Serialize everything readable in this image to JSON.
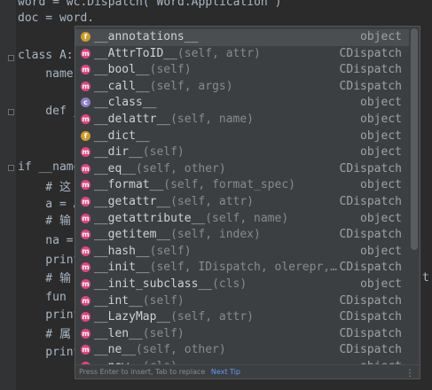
{
  "editor": {
    "lines": [
      {
        "text": "word = wc.Dispatch('Word.Application')"
      },
      {
        "text": "doc = word."
      },
      {
        "text": ""
      },
      {
        "text": "class A:"
      },
      {
        "text": "    name"
      },
      {
        "text": ""
      },
      {
        "text": "    def _"
      },
      {
        "text": ""
      },
      {
        "text": ""
      },
      {
        "text": "if __name"
      },
      {
        "text": "    # 这"
      },
      {
        "text": "    a = A"
      },
      {
        "text": "    # 输"
      },
      {
        "text": "    na ="
      },
      {
        "text": "    print"
      },
      {
        "text": "    # 输"
      },
      {
        "text": "    fun"
      },
      {
        "text": "    print"
      },
      {
        "text": "    # 属"
      },
      {
        "text": "    print"
      }
    ],
    "right_edge_char": "t"
  },
  "completion": {
    "items": [
      {
        "icon": "f",
        "name": "__annotations__",
        "sig": "",
        "type": "object"
      },
      {
        "icon": "m",
        "name": "__AttrToID__",
        "sig": "(self, attr)",
        "type": "CDispatch"
      },
      {
        "icon": "m",
        "name": "__bool__",
        "sig": "(self)",
        "type": "CDispatch"
      },
      {
        "icon": "m",
        "name": "__call__",
        "sig": "(self, args)",
        "type": "CDispatch"
      },
      {
        "icon": "c",
        "name": "__class__",
        "sig": "",
        "type": "object"
      },
      {
        "icon": "m",
        "name": "__delattr__",
        "sig": "(self, name)",
        "type": "object"
      },
      {
        "icon": "f",
        "name": "__dict__",
        "sig": "",
        "type": "object"
      },
      {
        "icon": "m",
        "name": "__dir__",
        "sig": "(self)",
        "type": "object"
      },
      {
        "icon": "m",
        "name": "__eq__",
        "sig": "(self, other)",
        "type": "CDispatch"
      },
      {
        "icon": "m",
        "name": "__format__",
        "sig": "(self, format_spec)",
        "type": "object"
      },
      {
        "icon": "m",
        "name": "__getattr__",
        "sig": "(self, attr)",
        "type": "CDispatch"
      },
      {
        "icon": "m",
        "name": "__getattribute__",
        "sig": "(self, name)",
        "type": "object"
      },
      {
        "icon": "m",
        "name": "__getitem__",
        "sig": "(self, index)",
        "type": "CDispatch"
      },
      {
        "icon": "m",
        "name": "__hash__",
        "sig": "(self)",
        "type": "object"
      },
      {
        "icon": "m",
        "name": "__init__",
        "sig": "(self, IDispatch, olerepr,…",
        "type": "CDispatch"
      },
      {
        "icon": "m",
        "name": "__init_subclass__",
        "sig": "(cls)",
        "type": "object"
      },
      {
        "icon": "m",
        "name": "__int__",
        "sig": "(self)",
        "type": "CDispatch"
      },
      {
        "icon": "m",
        "name": "__LazyMap__",
        "sig": "(self, attr)",
        "type": "CDispatch"
      },
      {
        "icon": "m",
        "name": "__len__",
        "sig": "(self)",
        "type": "CDispatch"
      },
      {
        "icon": "m",
        "name": "__ne__",
        "sig": "(self, other)",
        "type": "CDispatch"
      },
      {
        "icon": "m",
        "name": "__new__",
        "sig": "(cls)",
        "type": "object"
      }
    ],
    "footer_text": "Press Enter to insert, Tab to replace",
    "footer_tip": "Next Tip",
    "more_icon": "ellipsis-vertical-icon"
  }
}
